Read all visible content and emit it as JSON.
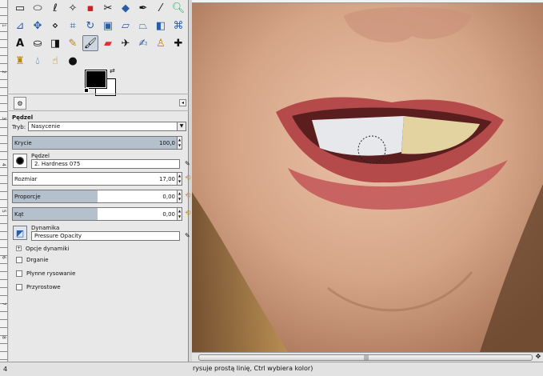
{
  "ruler": {
    "marks": [
      "1",
      "2",
      "3",
      "4",
      "5",
      "6",
      "7",
      "8"
    ]
  },
  "toolbox": {
    "tools_row1": [
      "rect-select-icon",
      "ellipse-select-icon",
      "lasso-icon",
      "fuzzy-select-icon",
      "color-select-icon",
      "scissors-icon",
      "foreground-select-icon",
      "paths-icon",
      "color-picker-icon",
      "zoom-icon"
    ],
    "tools_row2": [
      "measure-icon",
      "move-icon",
      "align-icon",
      "crop-icon",
      "rotate-icon",
      "scale-icon",
      "shear-icon",
      "perspective-icon",
      "flip-icon",
      "cage-icon"
    ],
    "tools_row3": [
      "text-icon",
      "bucket-fill-icon",
      "blend-icon",
      "pencil-icon",
      "paintbrush-icon",
      "eraser-icon",
      "airbrush-icon",
      "ink-icon",
      "clone-icon",
      "heal-icon"
    ],
    "tools_row4": [
      "perspective-clone-icon",
      "blur-icon",
      "smudge-icon",
      "dodge-burn-icon"
    ]
  },
  "options": {
    "title": "Pędzel",
    "mode_label": "Tryb:",
    "mode_value": "Nasycenie",
    "opacity": {
      "label": "Krycie",
      "value": "100,0",
      "fraction": 1.0
    },
    "brush": {
      "label": "Pędzel",
      "value": "2. Hardness 075"
    },
    "size": {
      "label": "Rozmiar",
      "value": "17,00",
      "fraction": 0.0
    },
    "aspect": {
      "label": "Proporcje",
      "value": "0,00",
      "fraction": 0.5
    },
    "angle": {
      "label": "Kąt",
      "value": "0,00",
      "fraction": 0.5
    },
    "dynamics": {
      "label": "Dynamika",
      "value": "Pressure Opacity"
    },
    "dynamics_options": "Opcje dynamiki",
    "checks": [
      "Drganie",
      "Płynne rysowanie",
      "Przyrostowe"
    ]
  },
  "status": {
    "left": "4",
    "message": "rysuje prostą linię, Ctrl wybiera kolor)"
  },
  "colors": {
    "accent": "#b4c0cc",
    "reset": "#c9a000"
  }
}
